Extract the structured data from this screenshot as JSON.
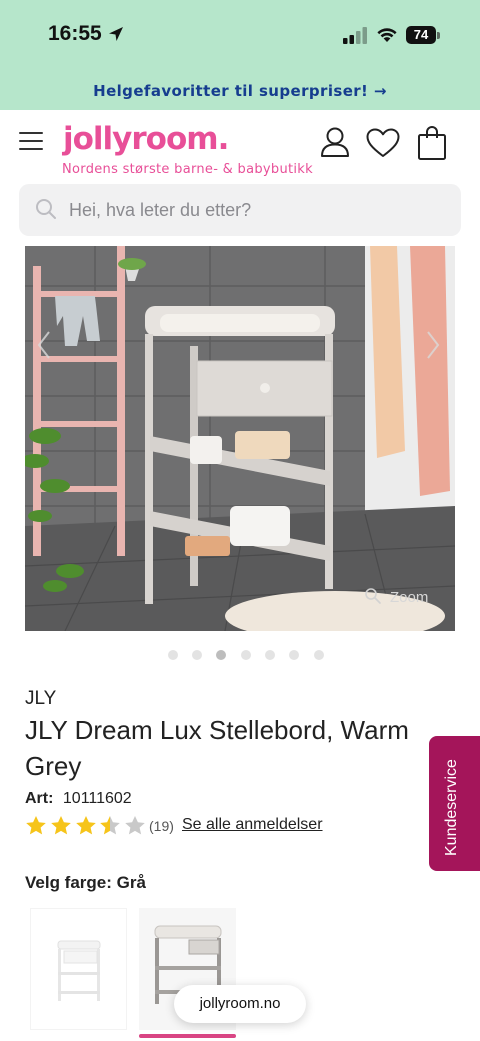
{
  "status_bar": {
    "time": "16:55",
    "battery": "74"
  },
  "promo_banner": {
    "text": "Helgefavoritter til superpriser! →"
  },
  "header": {
    "logo": "jollyroom.",
    "tagline": "Nordens største barne- & babybutikk"
  },
  "search": {
    "placeholder": "Hei, hva leter du etter?"
  },
  "gallery": {
    "zoom_label": "Zoom",
    "dot_count": 7,
    "active_dot": 2
  },
  "product": {
    "brand": "JLY",
    "title": "JLY Dream Lux Stellebord, Warm Grey",
    "art_label": "Art:",
    "art_number": "10111602",
    "rating": 3.5,
    "rating_max": 5,
    "review_count": "(19)",
    "review_link": "Se alle anmeldelser"
  },
  "customer_service": {
    "label": "Kundeservice"
  },
  "color_picker": {
    "label": "Velg farge: Grå",
    "options": [
      {
        "name": "white"
      },
      {
        "name": "grey",
        "selected": true
      }
    ]
  },
  "browser": {
    "url": "jollyroom.no"
  },
  "colors": {
    "status_bg": "#b6e6cb",
    "promo_text": "#163d8f",
    "brand_pink": "#e84f98",
    "side_tab": "#a4155a",
    "star": "#f6c41a",
    "star_empty": "#c9c9c9"
  }
}
